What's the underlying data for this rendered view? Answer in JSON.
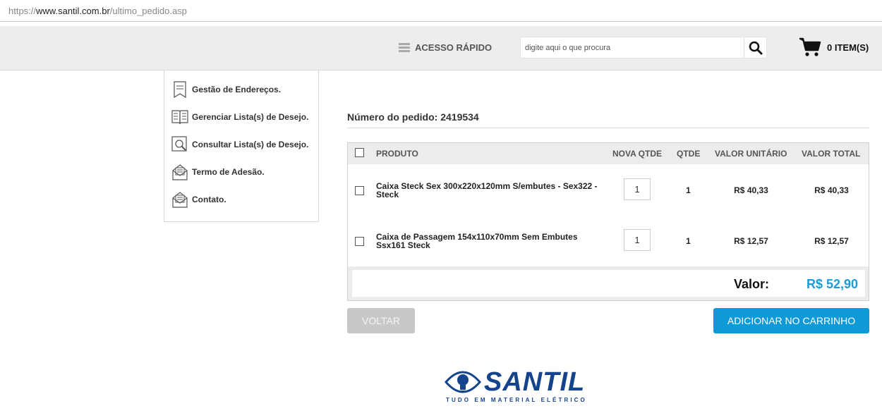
{
  "browser": {
    "url_scheme": "https://",
    "url_domain": "www.santil.com.br",
    "url_path": "/ultimo_pedido.asp"
  },
  "header": {
    "quick_access_label": "ACESSO RÁPIDO",
    "search_placeholder": "digite aqui o que procura",
    "cart_label": "0 ITEM(S)"
  },
  "sidebar": {
    "items": [
      {
        "label": "Gestão de Endereços.",
        "icon": "bookmark-document-icon"
      },
      {
        "label": "Gerenciar Lista(s) de Desejo.",
        "icon": "open-book-icon"
      },
      {
        "label": "Consultar Lista(s) de Desejo.",
        "icon": "search-document-icon"
      },
      {
        "label": "Termo de Adesão.",
        "icon": "envelope-letter-icon"
      },
      {
        "label": "Contato.",
        "icon": "envelope-letter-icon"
      }
    ]
  },
  "order": {
    "title": "Número do pedido: 2419534",
    "columns": {
      "product": "PRODUTO",
      "new_qty": "NOVA QTDE",
      "qty": "QTDE",
      "unit_value": "VALOR UNITÁRIO",
      "total_value": "VALOR TOTAL"
    },
    "rows": [
      {
        "product": "Caixa Steck Sex 300x220x120mm S/embutes - Sex322 - Steck",
        "new_qty": "1",
        "qty": "1",
        "unit_value": "R$ 40,33",
        "total_value": "R$ 40,33"
      },
      {
        "product": "Caixa de Passagem 154x110x70mm Sem Embutes Ssx161 Steck",
        "new_qty": "1",
        "qty": "1",
        "unit_value": "R$ 12,57",
        "total_value": "R$ 12,57"
      }
    ],
    "total_label": "Valor:",
    "total_value": "R$ 52,90"
  },
  "actions": {
    "back_label": "VOLTAR",
    "add_to_cart_label": "ADICIONAR NO CARRINHO"
  },
  "footer": {
    "logo_text": "SANTIL",
    "tagline": "TUDO EM MATERIAL ELÉTRICO"
  },
  "colors": {
    "accent": "#0f9ad7",
    "total_value": "#1b9ad6",
    "brand": "#15438c",
    "header_bg": "#ededed",
    "back_button": "#c8c8c8"
  }
}
